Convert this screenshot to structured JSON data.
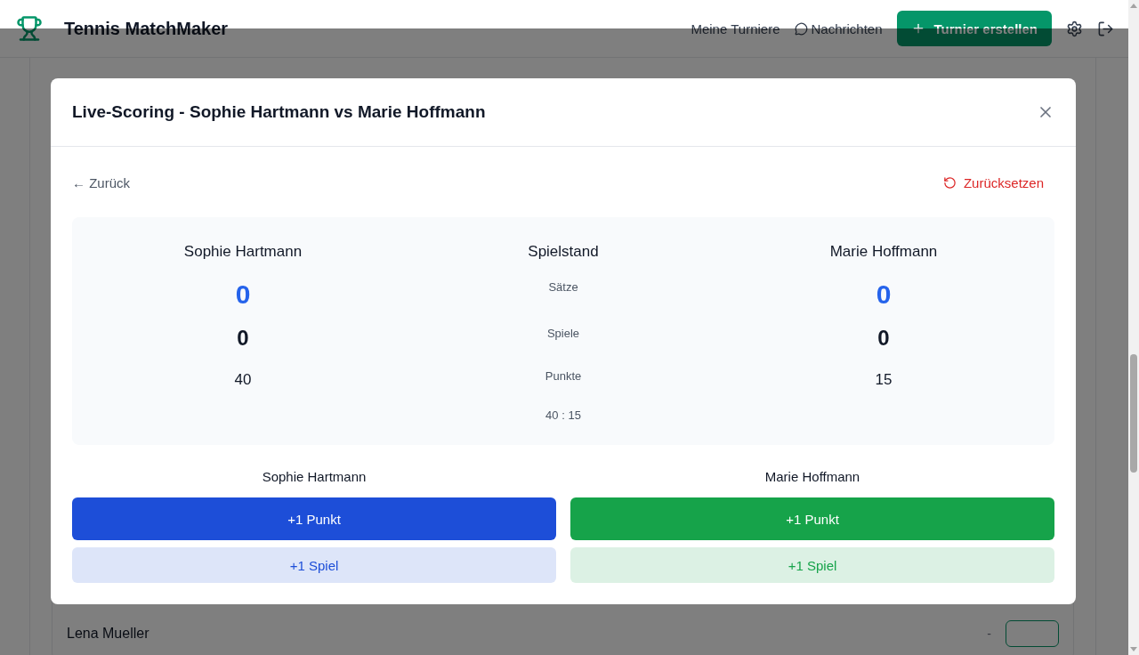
{
  "header": {
    "logo": "Tennis MatchMaker",
    "nav": [
      "Meine Turniere",
      "Nachrichten"
    ],
    "create_button": "Turnier erstellen"
  },
  "background": {
    "rows": [
      {
        "name": "Lena Mueller",
        "value": "-"
      }
    ]
  },
  "modal": {
    "title": "Live-Scoring - Sophie Hartmann vs Marie Hoffmann",
    "back": "← Zurück",
    "reset": "Zurücksetzen",
    "scoreboard": {
      "players": [
        {
          "name": "Sophie Hartmann",
          "sets": "0",
          "games": "0",
          "points": "40"
        },
        {
          "name": "Marie Hoffmann",
          "sets": "0",
          "games": "0",
          "points": "15"
        }
      ],
      "center": {
        "title": "Spielstand",
        "labels": [
          "Sätze",
          "Spiele",
          "Punkte"
        ],
        "summary": "40 : 15"
      }
    },
    "controls": [
      {
        "name": "Sophie Hartmann",
        "point_button": "+1 Punkt",
        "game_button": "+1 Spiel",
        "color": "#1d4ed8"
      },
      {
        "name": "Marie Hoffmann",
        "point_button": "+1 Punkt",
        "game_button": "+1 Spiel",
        "color": "#16a34a"
      }
    ]
  }
}
